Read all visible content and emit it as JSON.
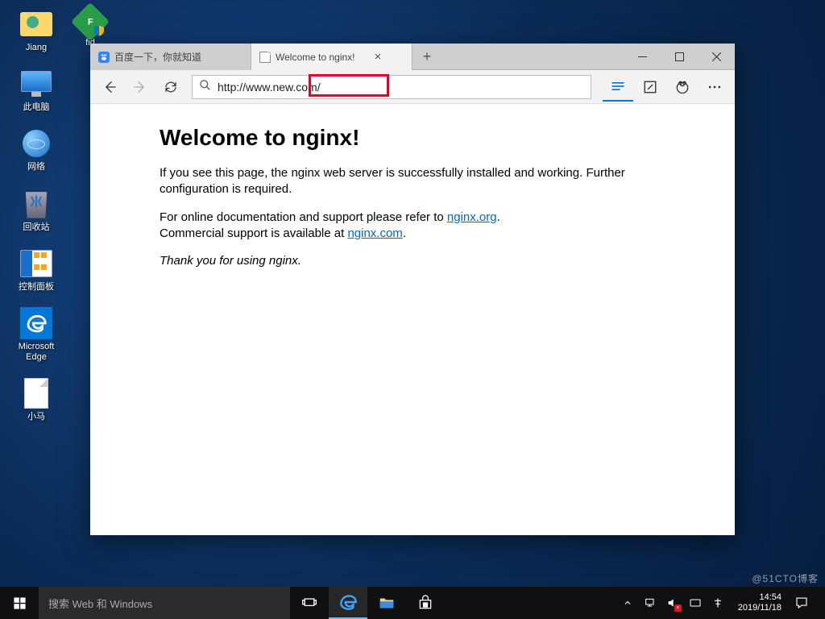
{
  "desktop": {
    "icons": [
      {
        "name": "folder-jiang",
        "label": "Jiang"
      },
      {
        "name": "this-pc",
        "label": "此电脑"
      },
      {
        "name": "network",
        "label": "网络"
      },
      {
        "name": "recycle-bin",
        "label": "回收站"
      },
      {
        "name": "control-panel",
        "label": "控制面板"
      },
      {
        "name": "microsoft-edge",
        "label": "Microsoft Edge"
      },
      {
        "name": "text-file-xiaoma",
        "label": "小马"
      }
    ],
    "fiddler_label": "fid"
  },
  "browser": {
    "tabs": [
      {
        "title": "百度一下，你就知道"
      },
      {
        "title": "Welcome to nginx!"
      }
    ],
    "address": "http://www.new.com/",
    "page": {
      "heading": "Welcome to nginx!",
      "p1": "If you see this page, the nginx web server is successfully installed and working. Further configuration is required.",
      "p2a": "For online documentation and support please refer to ",
      "link1": "nginx.org",
      "p2b": ".",
      "p3a": "Commercial support is available at ",
      "link2": "nginx.com",
      "p3b": ".",
      "thank": "Thank you for using nginx."
    }
  },
  "taskbar": {
    "search_placeholder": "搜索 Web 和 Windows",
    "clock_time": "14:54",
    "clock_date": "2019/11/18"
  },
  "watermark": "@51CTO博客"
}
